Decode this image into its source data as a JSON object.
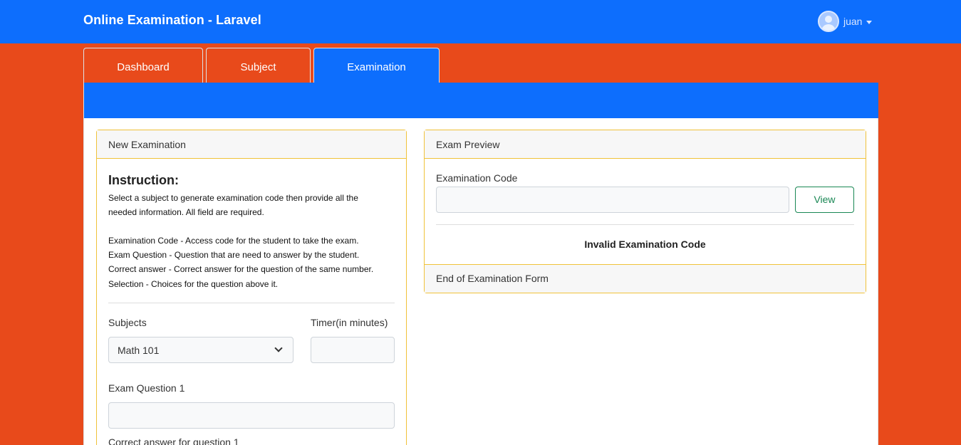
{
  "header": {
    "brand": "Online Examination - Laravel",
    "user_name": "juan"
  },
  "tabs": [
    {
      "label": "Dashboard",
      "active": false
    },
    {
      "label": "Subject",
      "active": false
    },
    {
      "label": "Examination",
      "active": true
    }
  ],
  "new_exam": {
    "title": "New Examination",
    "instruction_title": "Instruction:",
    "instruction_lines": [
      "Select a subject to generate examination code then provide all the",
      "needed information. All field are required.",
      "Examination Code - Access code for the student to take the exam.",
      "Exam Question - Question that are need to answer by the student.",
      "Correct answer - Correct answer for the question of the same number.",
      "Selection - Choices for the question above it."
    ],
    "subjects_label": "Subjects",
    "subject_selected": "Math 101",
    "timer_label": "Timer(in minutes)",
    "timer_value": "",
    "question_label": "Exam Question 1",
    "question_value": "",
    "correct_answer_label": "Correct answer for question 1"
  },
  "preview": {
    "title": "Exam Preview",
    "code_label": "Examination Code",
    "code_value": "",
    "view_button": "View",
    "status_message": "Invalid Examination Code",
    "footer": "End of Examination Form"
  },
  "colors": {
    "background": "#e84a1b",
    "primary": "#0d6efd",
    "card_border": "#f0c23a",
    "success": "#198754"
  }
}
